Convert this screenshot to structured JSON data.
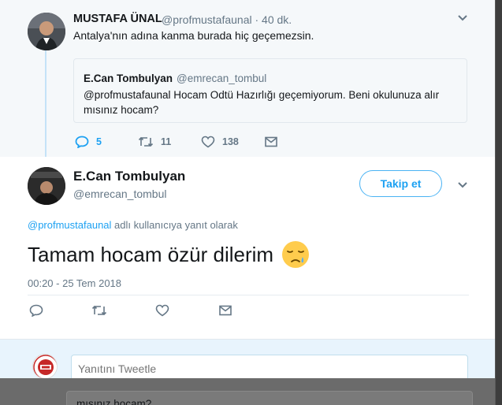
{
  "parent_tweet": {
    "author_name": "MUSTAFA ÜNAL",
    "handle_time": "@profmustafaunal · 40 dk.",
    "text": "Antalya'nın adına kanma burada hiç geçemezsin.",
    "quoted": {
      "author_name": "E.Can Tombulyan",
      "handle": "@emrecan_tombul",
      "text": "@profmustafaunal Hocam Odtü Hazırlığı geçemiyorum. Beni okulunuza alır mısınız hocam?"
    },
    "actions": {
      "replies": "5",
      "retweets": "11",
      "likes": "138"
    }
  },
  "main_tweet": {
    "author_name": "E.Can Tombulyan",
    "handle": "@emrecan_tombul",
    "follow_label": "Takip et",
    "reply_to_mention": "@profmustafaunal",
    "reply_to_suffix": "adlı kullanıcıya yanıt olarak",
    "text": "Tamam hocam özür dilerim",
    "emoji": "sad-relieved-face-emoji",
    "timestamp": "00:20 - 25 Tem 2018"
  },
  "reply_box": {
    "placeholder": "Yanıtını Tweetle"
  },
  "background_peek": {
    "text": "mısınız hocam?"
  },
  "colors": {
    "accent": "#1da1f2",
    "secondary_text": "#657786",
    "thread_line": "#c4e2f7"
  }
}
